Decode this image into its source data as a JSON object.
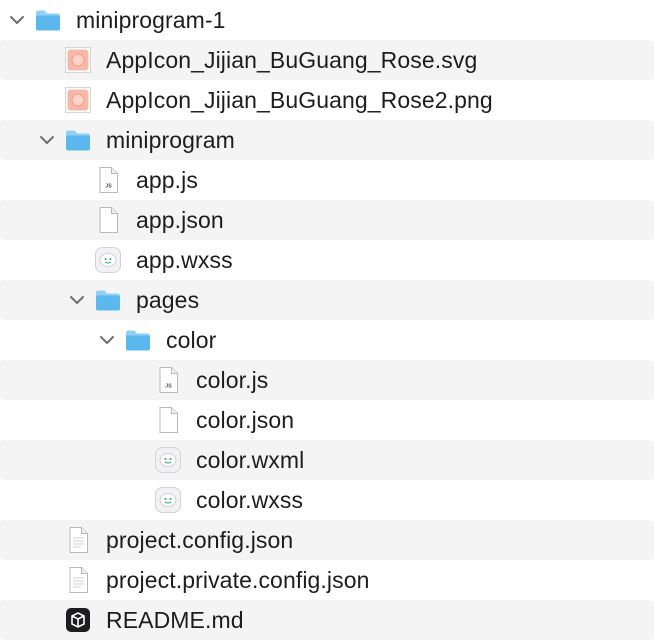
{
  "file_tree": {
    "rows": [
      {
        "label": "miniprogram-1",
        "type": "folder",
        "expanded": true,
        "depth": 0,
        "icon": "folder-icon"
      },
      {
        "label": "AppIcon_Jijian_BuGuang_Rose.svg",
        "type": "image",
        "depth": 1,
        "icon": "image-thumbnail-icon"
      },
      {
        "label": "AppIcon_Jijian_BuGuang_Rose2.png",
        "type": "image",
        "depth": 1,
        "icon": "image-thumbnail-icon"
      },
      {
        "label": "miniprogram",
        "type": "folder",
        "expanded": true,
        "depth": 1,
        "icon": "folder-icon"
      },
      {
        "label": "app.js",
        "type": "js",
        "depth": 2,
        "icon": "js-file-icon",
        "badge": "JS"
      },
      {
        "label": "app.json",
        "type": "file",
        "depth": 2,
        "icon": "document-icon"
      },
      {
        "label": "app.wxss",
        "type": "wechat",
        "depth": 2,
        "icon": "wechat-file-icon"
      },
      {
        "label": "pages",
        "type": "folder",
        "expanded": true,
        "depth": 2,
        "icon": "folder-icon"
      },
      {
        "label": "color",
        "type": "folder",
        "expanded": true,
        "depth": 3,
        "icon": "folder-icon"
      },
      {
        "label": "color.js",
        "type": "js",
        "depth": 4,
        "icon": "js-file-icon",
        "badge": "JS"
      },
      {
        "label": "color.json",
        "type": "file",
        "depth": 4,
        "icon": "document-icon"
      },
      {
        "label": "color.wxml",
        "type": "wechat",
        "depth": 4,
        "icon": "wechat-file-icon"
      },
      {
        "label": "color.wxss",
        "type": "wechat",
        "depth": 4,
        "icon": "wechat-file-icon"
      },
      {
        "label": "project.config.json",
        "type": "textfile",
        "depth": 1,
        "icon": "text-file-icon"
      },
      {
        "label": "project.private.config.json",
        "type": "textfile",
        "depth": 1,
        "icon": "text-file-icon"
      },
      {
        "label": "README.md",
        "type": "markdown",
        "depth": 1,
        "icon": "markdown-app-icon"
      }
    ]
  },
  "colors": {
    "folder_top": "#8fd0f7",
    "folder_body": "#5bb8ef",
    "stripe": "#f4f4f5",
    "chevron": "#6e6e73",
    "text": "#1d1d1f"
  }
}
